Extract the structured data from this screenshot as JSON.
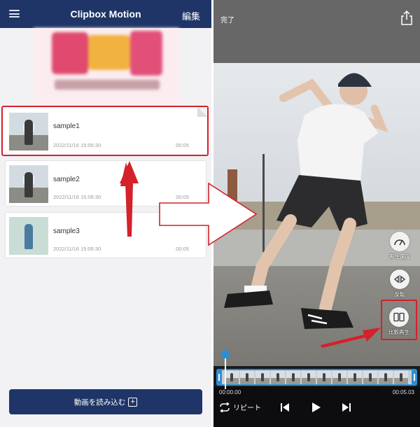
{
  "left_app": {
    "title": "Clipbox Motion",
    "edit_label": "編集",
    "videos": [
      {
        "title": "sample1",
        "date": "2022/11/16 15:05:30",
        "duration": "00:05"
      },
      {
        "title": "sample2",
        "date": "2022/11/16 15:05:30",
        "duration": "00:05"
      },
      {
        "title": "sample3",
        "date": "2022/11/16 15:05:30",
        "duration": "00:05"
      }
    ],
    "import_label": "動画を読み込む",
    "import_icon": "plus-square-icon"
  },
  "right_app": {
    "done_label": "完了",
    "share_icon": "share-icon",
    "controls": [
      {
        "label": "再生速度",
        "icon": "speed-gauge-icon"
      },
      {
        "label": "反転",
        "icon": "flip-icon"
      },
      {
        "label": "比較再生",
        "icon": "split-compare-icon"
      }
    ],
    "time_start": "00:00.00",
    "time_end": "00:05.03",
    "repeat_label": "リピート",
    "playback_icons": [
      "step-back-icon",
      "play-icon",
      "step-forward-icon"
    ]
  },
  "colors": {
    "header_navy": "#1f3568",
    "highlight_red": "#d4212a",
    "timeline_blue": "#2c8fd6"
  }
}
